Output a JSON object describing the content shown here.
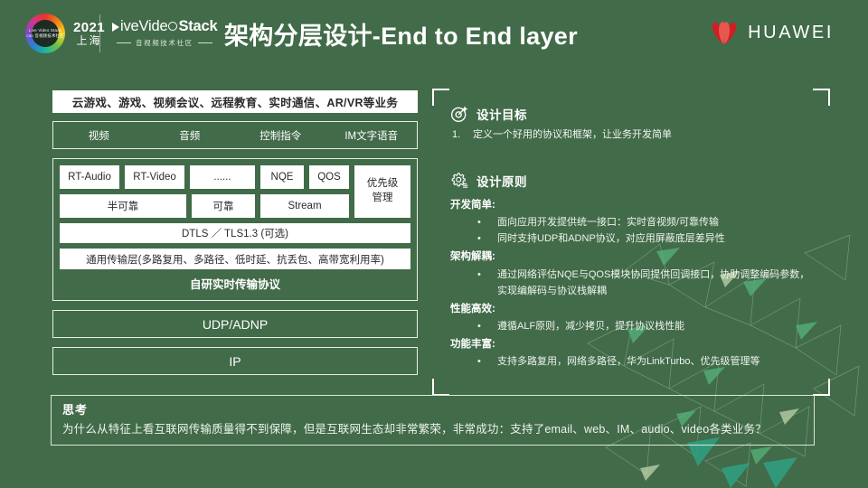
{
  "header": {
    "event_year": "2021",
    "event_city": "上海",
    "ring_text": "Live Video Stack con 音视频技术社区",
    "brand_live": "ive",
    "brand_video": "Vide",
    "brand_stack": "Stack",
    "brand_sub": "音视频技术社区",
    "title": "架构分层设计-End to End layer",
    "vendor": "HUAWEI",
    "vendor_logo_icon": "huawei-petal-icon"
  },
  "diagram": {
    "applications": "云游戏、游戏、视频会议、远程教育、实时通信、AR/VR等业务",
    "media_types": [
      "视频",
      "音频",
      "控制指令",
      "IM文字语音"
    ],
    "modules_row1": [
      "RT-Audio",
      "RT-Video",
      "......",
      "NQE",
      "QOS"
    ],
    "modules_row2": [
      "半可靠",
      "可靠",
      "Stream"
    ],
    "priority_module": "优先级\n管理",
    "priority_module_line1": "优先级",
    "priority_module_line2": "管理",
    "security_layer": "DTLS ／ TLS1.3 (可选)",
    "transport_layer": "通用传输层(多路复用、多路径、低时延、抗丢包、高带宽利用率)",
    "protocol_caption": "自研实时传输协议",
    "udp_layer": "UDP/ADNP",
    "ip_layer": "IP"
  },
  "panel": {
    "goal": {
      "icon": "target-goal-icon",
      "title": "设计目标",
      "items": [
        {
          "num": "1.",
          "text": "定义一个好用的协议和框架，让业务开发简单"
        }
      ]
    },
    "principle": {
      "icon": "gear-settings-icon",
      "title": "设计原则",
      "groups": [
        {
          "title": "开发简单:",
          "bullets": [
            "面向应用开发提供统一接口：实时音视频/可靠传输",
            "同时支持UDP和ADNP协议，对应用屏蔽底层差异性"
          ]
        },
        {
          "title": "架构解耦:",
          "bullets": [
            "通过网络评估NQE与QOS模块协同提供回调接口，协助调整编码参数，实现编解码与协议栈解耦"
          ]
        },
        {
          "title": "性能高效:",
          "bullets": [
            "遵循ALF原则，减少拷贝，提升协议栈性能"
          ]
        },
        {
          "title": "功能丰富:",
          "bullets": [
            "支持多路复用，网络多路径，华为LinkTurbo、优先级管理等"
          ]
        }
      ]
    }
  },
  "think": {
    "title": "思考",
    "body": "为什么从特征上看互联网传输质量得不到保障，但是互联网生态却非常繁荣，非常成功：支持了email、web、IM、audio、video各类业务？"
  },
  "colors": {
    "background": "#426b49",
    "box_white": "#ffffff",
    "outline": "#e7eee9",
    "text_light": "#ffffff",
    "huawei_red": "#cf1f25"
  }
}
